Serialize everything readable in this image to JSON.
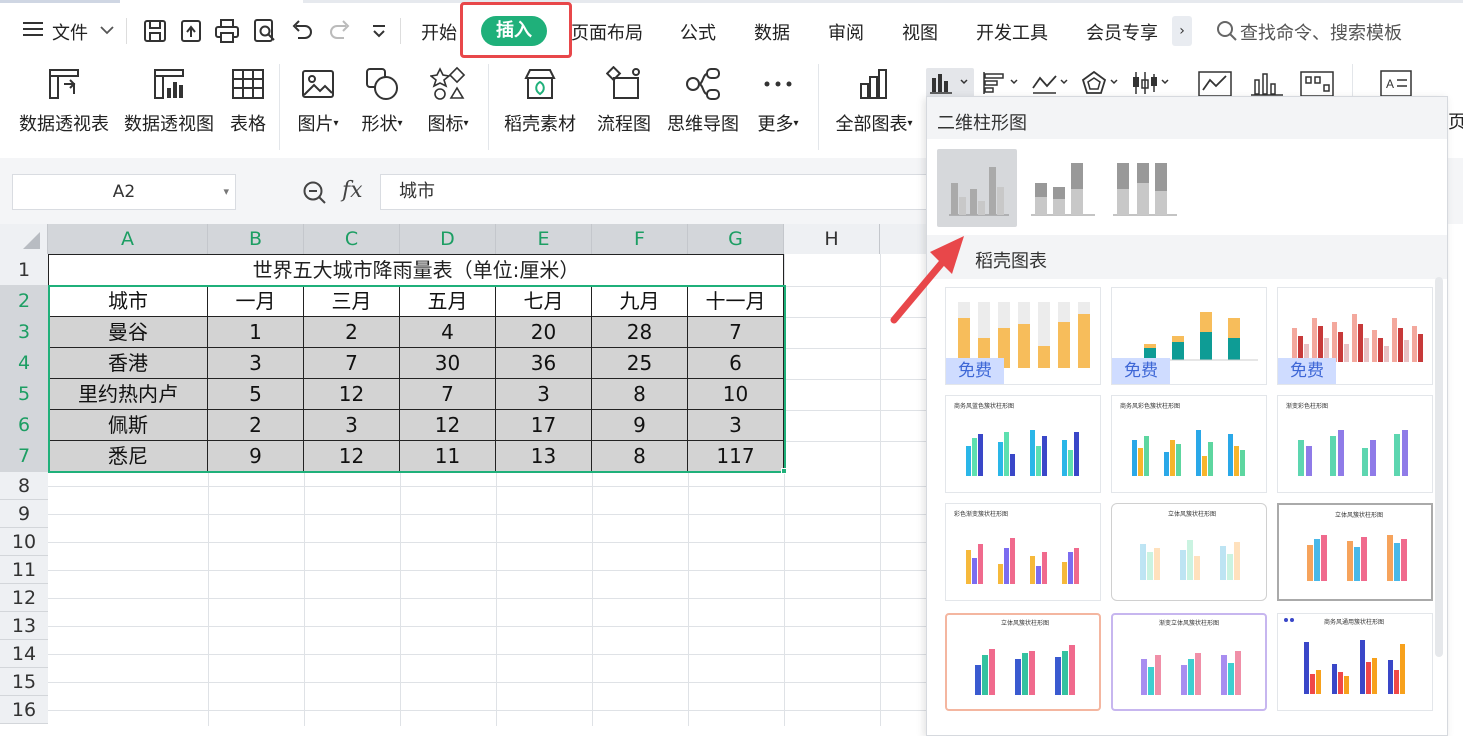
{
  "menubar": {
    "file_label": "文件",
    "tabs": [
      "开始",
      "插入",
      "页面布局",
      "公式",
      "数据",
      "审阅",
      "视图",
      "开发工具",
      "会员专享"
    ],
    "active_tab": "插入",
    "more_tabs": "›",
    "search_placeholder": "查找命令、搜索模板"
  },
  "ribbon": {
    "buttons": [
      {
        "label": "数据透视表",
        "icon": "pivot-table-icon"
      },
      {
        "label": "数据透视图",
        "icon": "pivot-chart-icon"
      },
      {
        "label": "表格",
        "icon": "table-icon"
      },
      {
        "label": "图片",
        "icon": "picture-icon"
      },
      {
        "label": "形状",
        "icon": "shape-icon"
      },
      {
        "label": "图标",
        "icon": "icons-icon"
      },
      {
        "label": "稻壳素材",
        "icon": "docer-material-icon"
      },
      {
        "label": "流程图",
        "icon": "flowchart-icon"
      },
      {
        "label": "思维导图",
        "icon": "mindmap-icon"
      },
      {
        "label": "更多",
        "icon": "more-icon"
      },
      {
        "label": "全部图表",
        "icon": "all-charts-icon"
      }
    ],
    "cut_off_label": "页"
  },
  "formula_bar": {
    "name_box": "A2",
    "fx_label": "fx",
    "formula_value": "城市"
  },
  "sheet": {
    "columns": [
      "A",
      "B",
      "C",
      "D",
      "E",
      "F",
      "G",
      "H"
    ],
    "rows": [
      "1",
      "2",
      "3",
      "4",
      "5",
      "6",
      "7",
      "8",
      "9",
      "10",
      "11",
      "12",
      "13",
      "14",
      "15",
      "16"
    ],
    "title": "世界五大城市降雨量表（单位:厘米）",
    "table_header": [
      "城市",
      "一月",
      "三月",
      "五月",
      "七月",
      "九月",
      "十一月"
    ],
    "table_rows": [
      [
        "曼谷",
        "1",
        "2",
        "4",
        "20",
        "28",
        "7"
      ],
      [
        "香港",
        "3",
        "7",
        "30",
        "36",
        "25",
        "6"
      ],
      [
        "里约热内卢",
        "5",
        "12",
        "7",
        "3",
        "8",
        "10"
      ],
      [
        "佩斯",
        "2",
        "3",
        "12",
        "17",
        "9",
        "3"
      ],
      [
        "悉尼",
        "9",
        "12",
        "11",
        "13",
        "8",
        "117"
      ]
    ]
  },
  "chart_panel": {
    "section_2d": "二维柱形图",
    "section_docer": "稻壳图表",
    "free_badge": "免费",
    "card_titles": [
      "商务风蓝色簇状柱形图",
      "商务风彩色簇状柱形图",
      "渐变彩色柱形图",
      "彩色渐变簇状柱形图",
      "立体风簇状柱形图",
      "立体风簇状柱形图",
      "立体风簇状柱形图",
      "渐变立体风簇状柱形图",
      "商务风通用簇状柱形图"
    ]
  },
  "colors": {
    "accent_green": "#1fb07a",
    "highlight_red": "#e8474a",
    "selection_green": "#1c9e63"
  }
}
